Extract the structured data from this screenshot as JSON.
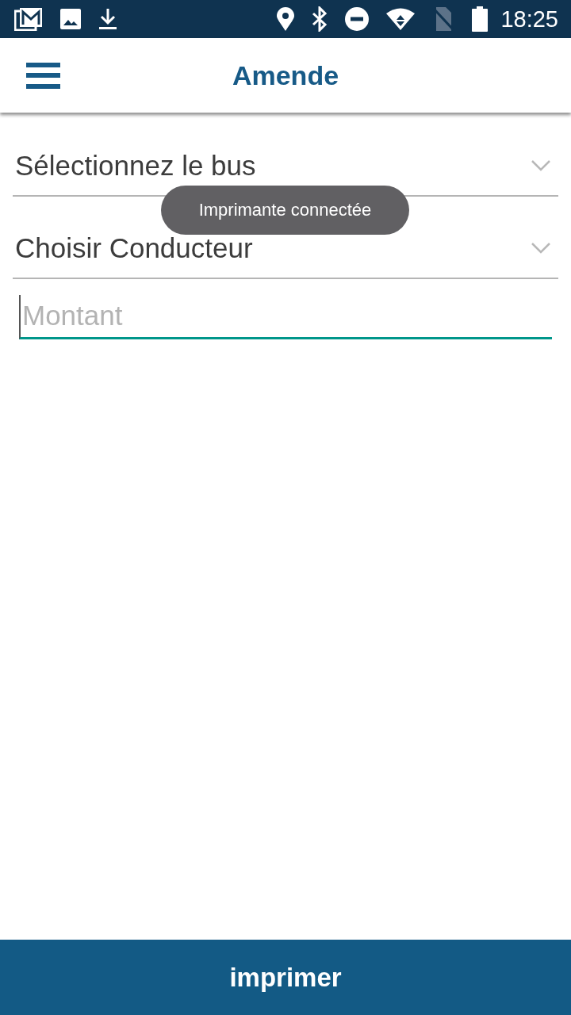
{
  "status_bar": {
    "time": "18:25"
  },
  "app_bar": {
    "title": "Amende"
  },
  "dropdowns": [
    {
      "label": "Sélectionnez le bus"
    },
    {
      "label": "Choisir Conducteur"
    }
  ],
  "amount_field": {
    "placeholder": "Montant",
    "focused": true
  },
  "toast": {
    "text": "Imprimante connectée"
  },
  "print_button": {
    "label": "imprimer"
  }
}
